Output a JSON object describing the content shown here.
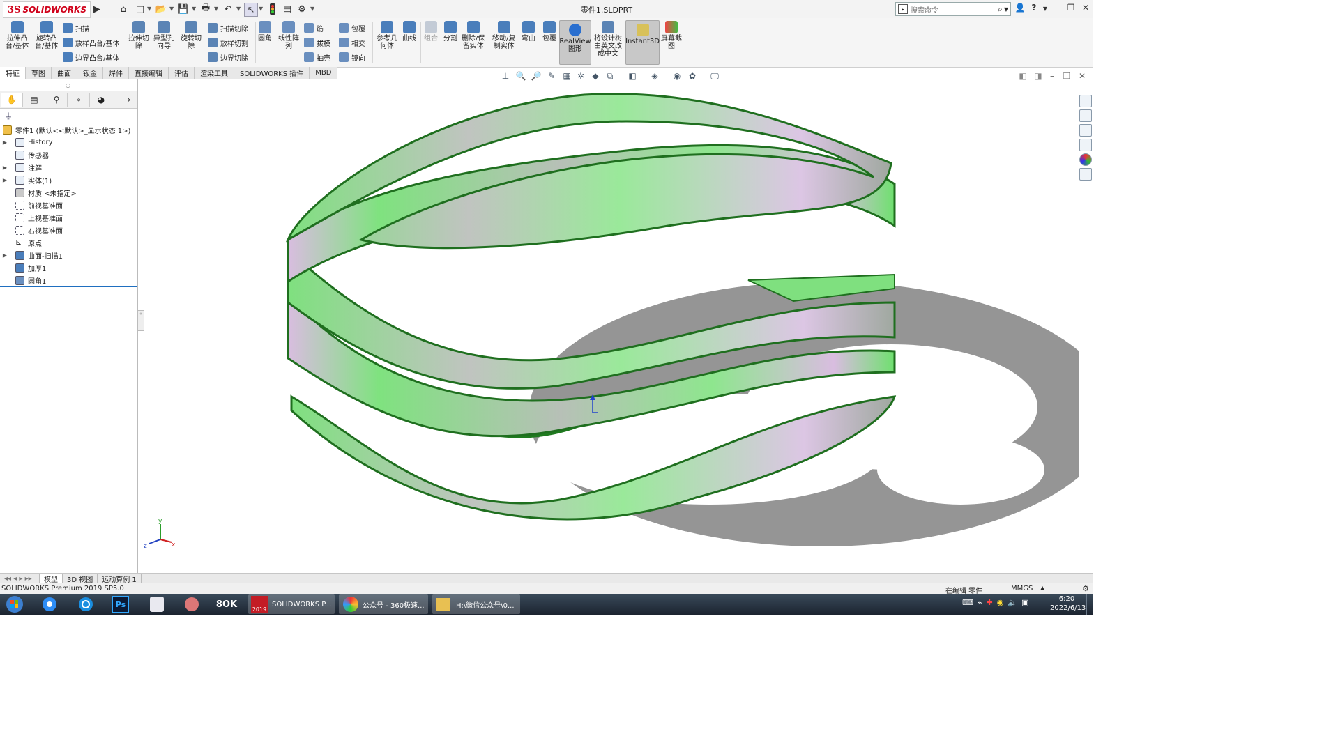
{
  "app": {
    "brand_ds": "3S",
    "brand_name": "SOLIDWORKS",
    "document_title": "零件1.SLDPRT",
    "search_placeholder": "搜索命令",
    "help_icon": "?"
  },
  "ribbon": {
    "features": [
      {
        "label": "拉伸凸\n台/基体",
        "icon": "extrude-boss-icon"
      },
      {
        "label": "旋转凸\n台/基体",
        "icon": "revolve-boss-icon"
      }
    ],
    "boss_small": [
      "扫描",
      "放样凸台/基体",
      "边界凸台/基体"
    ],
    "cut_big": [
      {
        "label": "拉伸切\n除",
        "icon": "extrude-cut-icon"
      },
      {
        "label": "异型孔\n向导",
        "icon": "hole-wizard-icon"
      },
      {
        "label": "旋转切\n除",
        "icon": "revolve-cut-icon"
      }
    ],
    "cut_small": [
      "扫描切除",
      "放样切割",
      "边界切除"
    ],
    "fillet_big": [
      {
        "label": "圆角",
        "icon": "fillet-icon"
      },
      {
        "label": "线性阵\n列",
        "icon": "linear-pattern-icon"
      }
    ],
    "rib_small": [
      "筋",
      "拔模",
      "抽壳"
    ],
    "wrap_small": [
      "包覆",
      "相交",
      "镜向"
    ],
    "ref_big": [
      {
        "label": "参考几\n何体",
        "icon": "reference-geometry-icon"
      },
      {
        "label": "曲线",
        "icon": "curves-icon"
      }
    ],
    "misc_big": [
      {
        "label": "组合",
        "icon": "combine-icon"
      },
      {
        "label": "分割",
        "icon": "split-icon"
      },
      {
        "label": "删除/保\n留实体",
        "icon": "delete-body-icon"
      },
      {
        "label": "移动/复\n制实体",
        "icon": "move-copy-icon"
      },
      {
        "label": "弯曲",
        "icon": "flex-icon"
      },
      {
        "label": "包覆",
        "icon": "wrap-icon"
      },
      {
        "label": "RealView\n图形",
        "icon": "realview-icon"
      },
      {
        "label": "将设计树\n由英文改\n成中文",
        "icon": "design-tree-icon"
      },
      {
        "label": "Instant3D",
        "icon": "instant3d-icon"
      },
      {
        "label": "屏幕截\n图",
        "icon": "screen-capture-icon"
      }
    ]
  },
  "tabs": [
    "特征",
    "草图",
    "曲面",
    "钣金",
    "焊件",
    "直接编辑",
    "评估",
    "渲染工具",
    "SOLIDWORKS 插件",
    "MBD"
  ],
  "tree": {
    "root": "零件1 (默认<<默认>_显示状态 1>)",
    "items": [
      {
        "label": "History",
        "expandable": true
      },
      {
        "label": "传感器",
        "expandable": false
      },
      {
        "label": "注解",
        "expandable": true
      },
      {
        "label": "实体(1)",
        "expandable": true
      },
      {
        "label": "材质 <未指定>",
        "expandable": false
      },
      {
        "label": "前视基准面",
        "expandable": false
      },
      {
        "label": "上视基准面",
        "expandable": false
      },
      {
        "label": "右视基准面",
        "expandable": false
      },
      {
        "label": "原点",
        "expandable": false
      },
      {
        "label": "曲面-扫描1",
        "expandable": true
      },
      {
        "label": "加厚1",
        "expandable": false
      },
      {
        "label": "圆角1",
        "expandable": false
      }
    ]
  },
  "bottom_tabs": [
    "模型",
    "3D 视图",
    "运动算例 1"
  ],
  "status": {
    "left": "SOLIDWORKS Premium 2019 SP5.0",
    "editing": "在编辑 零件",
    "units": "MMGS"
  },
  "taskbar": {
    "apps": [
      {
        "label": "SOLIDWORKS P...",
        "badge": "2019"
      },
      {
        "label": "公众号 - 360极速..."
      },
      {
        "label": "H:\\微信公众号\\0..."
      }
    ],
    "time": "6:20",
    "date": "2022/6/13"
  },
  "axes": {
    "x": "x",
    "y": "y",
    "z": "z"
  },
  "colors": {
    "accent_red": "#d0021b",
    "model_green": "#6fe06f",
    "model_edge": "#1f7a1f",
    "model_gray": "#b0b5b0",
    "model_pink": "#d9bde0"
  }
}
